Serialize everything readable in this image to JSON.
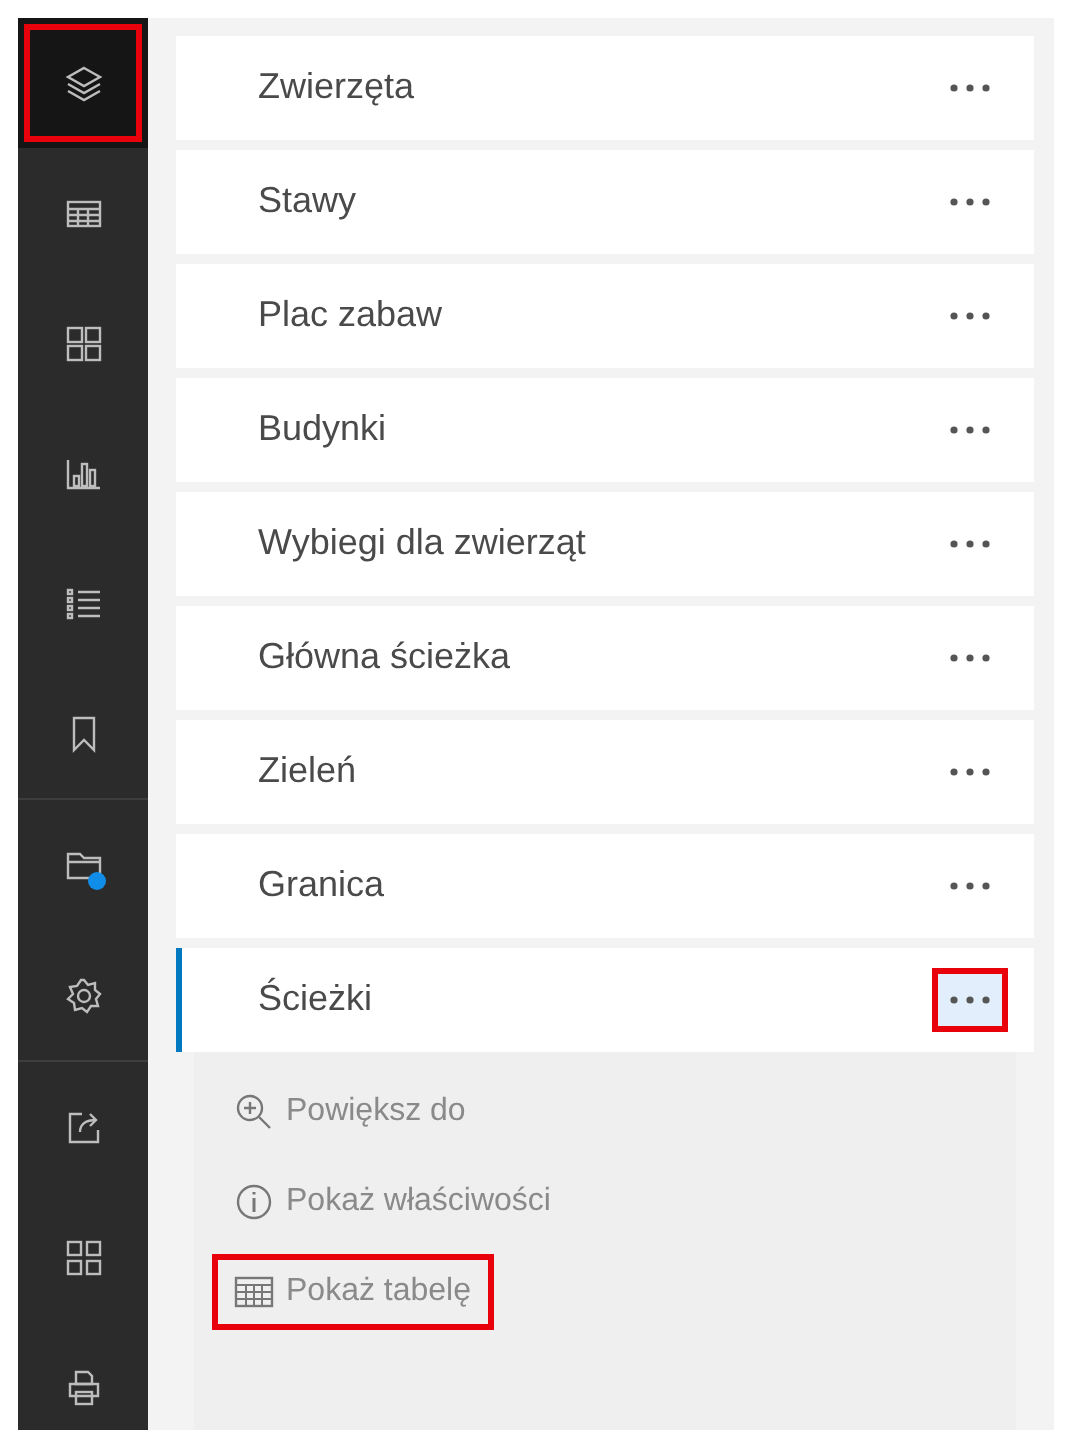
{
  "sidebar": {
    "groups": [
      [
        {
          "selected": true,
          "highlighted": true
        },
        {
          "selected": false,
          "highlighted": false
        },
        {
          "selected": false,
          "highlighted": false
        },
        {
          "selected": false,
          "highlighted": false
        },
        {
          "selected": false,
          "highlighted": false
        },
        {
          "selected": false,
          "highlighted": false
        }
      ],
      [
        {
          "selected": false,
          "highlighted": false,
          "notification": true
        },
        {
          "selected": false,
          "highlighted": false,
          "notification": false
        }
      ],
      [
        {
          "selected": false,
          "highlighted": false
        },
        {
          "selected": false,
          "highlighted": false
        },
        {
          "selected": false,
          "highlighted": false
        }
      ]
    ]
  },
  "layers": [
    {
      "name": "Zwierzęta",
      "selected": false,
      "menu_highlighted": false
    },
    {
      "name": "Stawy",
      "selected": false,
      "menu_highlighted": false
    },
    {
      "name": "Plac zabaw",
      "selected": false,
      "menu_highlighted": false
    },
    {
      "name": "Budynki",
      "selected": false,
      "menu_highlighted": false
    },
    {
      "name": "Wybiegi dla zwierząt",
      "selected": false,
      "menu_highlighted": false
    },
    {
      "name": "Główna ścieżka",
      "selected": false,
      "menu_highlighted": false
    },
    {
      "name": "Zieleń",
      "selected": false,
      "menu_highlighted": false
    },
    {
      "name": "Granica",
      "selected": false,
      "menu_highlighted": false
    },
    {
      "name": "Ścieżki",
      "selected": true,
      "menu_highlighted": true
    }
  ],
  "layer_menu": [
    {
      "label": "Powiększ do",
      "highlighted": false
    },
    {
      "label": "Pokaż właściwości",
      "highlighted": false
    },
    {
      "label": "Pokaż tabelę",
      "highlighted": true
    }
  ]
}
